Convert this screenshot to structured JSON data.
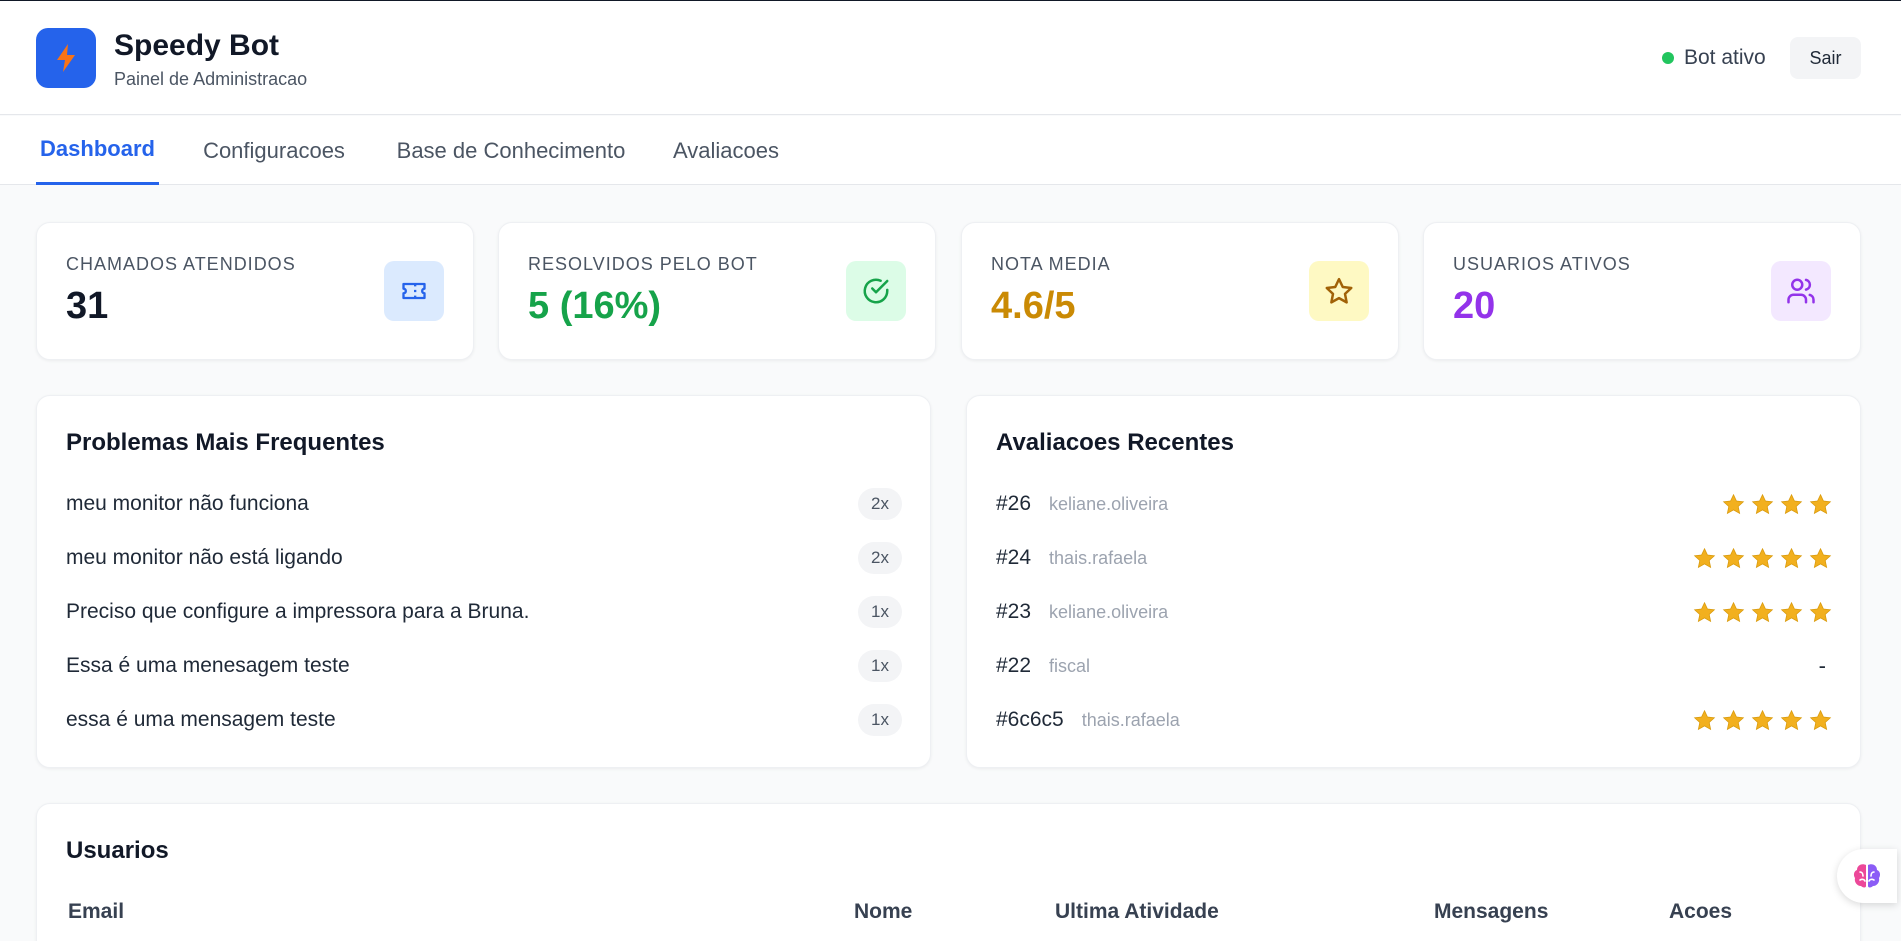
{
  "app": {
    "title": "Speedy Bot",
    "subtitle": "Painel de Administracao",
    "status": "Bot ativo",
    "logout_label": "Sair"
  },
  "tabs": [
    {
      "label": "Dashboard",
      "active": true
    },
    {
      "label": "Configuracoes",
      "active": false
    },
    {
      "label": "Base de Conhecimento",
      "active": false
    },
    {
      "label": "Avaliacoes",
      "active": false
    }
  ],
  "stats": [
    {
      "label": "CHAMADOS ATENDIDOS",
      "value": "31",
      "color": "#111827",
      "icon": "ticket-icon",
      "icon_bg": "#dbeafe",
      "icon_color": "#2563eb"
    },
    {
      "label": "RESOLVIDOS PELO BOT",
      "value": "5 (16%)",
      "color": "#16a34a",
      "icon": "check-circle-icon",
      "icon_bg": "#dcfce7",
      "icon_color": "#16a34a"
    },
    {
      "label": "NOTA MEDIA",
      "value": "4.6/5",
      "color": "#ca8a04",
      "icon": "star-icon",
      "icon_bg": "#fef9c3",
      "icon_color": "#a16207"
    },
    {
      "label": "USUARIOS ATIVOS",
      "value": "20",
      "color": "#9333ea",
      "icon": "users-icon",
      "icon_bg": "#f3e8ff",
      "icon_color": "#9333ea"
    }
  ],
  "problems": {
    "title": "Problemas Mais Frequentes",
    "items": [
      {
        "text": "meu monitor não funciona",
        "count": "2x"
      },
      {
        "text": "meu monitor não está ligando",
        "count": "2x"
      },
      {
        "text": "Preciso que configure a impressora para a Bruna.",
        "count": "1x"
      },
      {
        "text": "Essa é uma menesagem teste",
        "count": "1x"
      },
      {
        "text": "essa é uma mensagem teste",
        "count": "1x"
      }
    ]
  },
  "reviews": {
    "title": "Avaliacoes Recentes",
    "items": [
      {
        "id": "#26",
        "user": "keliane.oliveira",
        "stars": 4,
        "empty": ""
      },
      {
        "id": "#24",
        "user": "thais.rafaela",
        "stars": 5,
        "empty": ""
      },
      {
        "id": "#23",
        "user": "keliane.oliveira",
        "stars": 5,
        "empty": ""
      },
      {
        "id": "#22",
        "user": "fiscal",
        "stars": 0,
        "empty": "-"
      },
      {
        "id": "#6c6c5",
        "user": "thais.rafaela",
        "stars": 5,
        "empty": ""
      }
    ]
  },
  "users": {
    "title": "Usuarios",
    "columns": [
      "Email",
      "Nome",
      "Ultima Atividade",
      "Mensagens",
      "Acoes"
    ]
  },
  "colors": {
    "accent": "#2563eb",
    "star": "#f2b01e",
    "status_ok": "#22c55e"
  }
}
